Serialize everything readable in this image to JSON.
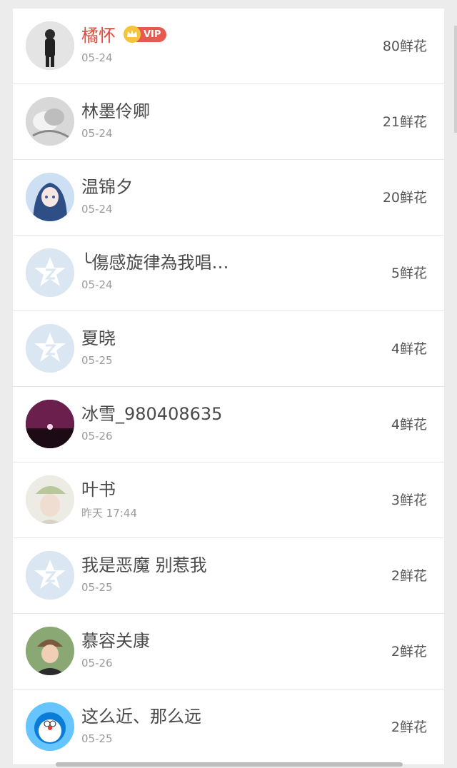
{
  "rows": [
    {
      "name": "橘怀",
      "date": "05-24",
      "flowers": "80鲜花",
      "avatar_icon": "person-photo-avatar",
      "vip": true,
      "vip_label": "VIP"
    },
    {
      "name": "林墨伶卿",
      "date": "05-24",
      "flowers": "21鲜花",
      "avatar_icon": "flower-photo-avatar"
    },
    {
      "name": "温锦夕",
      "date": "05-24",
      "flowers": "20鲜花",
      "avatar_icon": "anime-girl-avatar"
    },
    {
      "name": "╰傷感旋律為我唱…",
      "date": "05-24",
      "flowers": "5鲜花",
      "avatar_icon": "default-star-avatar"
    },
    {
      "name": "夏晓",
      "date": "05-25",
      "flowers": "4鲜花",
      "avatar_icon": "default-star-avatar"
    },
    {
      "name": "冰雪_980408635",
      "date": "05-26",
      "flowers": "4鲜花",
      "avatar_icon": "sunset-photo-avatar"
    },
    {
      "name": "叶书",
      "date": "昨天 17:44",
      "flowers": "3鲜花",
      "avatar_icon": "girl-hat-avatar"
    },
    {
      "name": "我是恶魔 别惹我",
      "date": "05-25",
      "flowers": "2鲜花",
      "avatar_icon": "default-star-avatar"
    },
    {
      "name": "慕容关康",
      "date": "05-26",
      "flowers": "2鲜花",
      "avatar_icon": "man-hat-avatar"
    },
    {
      "name": "这么近、那么远",
      "date": "05-25",
      "flowers": "2鲜花",
      "avatar_icon": "doraemon-avatar"
    }
  ],
  "colors": {
    "vip_name": "#e5493c",
    "default_avatar": "#dbe6f3",
    "default_star": "#ffffff"
  }
}
